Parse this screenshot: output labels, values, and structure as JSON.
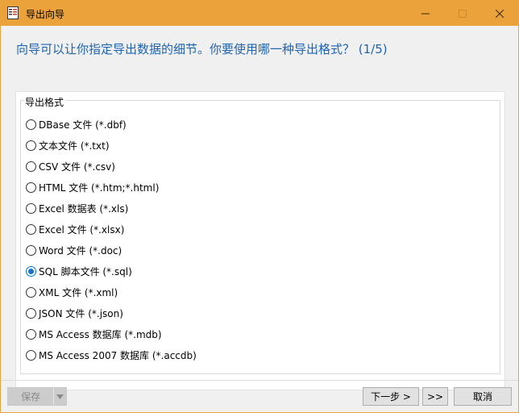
{
  "window": {
    "title": "导出向导",
    "minimize_icon": "minimize-icon",
    "maximize_icon": "maximize-icon",
    "close_icon": "close-icon",
    "accent_color": "#eba23a"
  },
  "header": {
    "text": "向导可以让你指定导出数据的细节。你要使用哪一种导出格式？ (1/5)",
    "color": "#1d64b4"
  },
  "format_group": {
    "legend": "导出格式",
    "selected_index": 7,
    "options": [
      {
        "label": "DBase 文件 (*.dbf)",
        "checked": false
      },
      {
        "label": "文本文件 (*.txt)",
        "checked": false
      },
      {
        "label": "CSV 文件 (*.csv)",
        "checked": false
      },
      {
        "label": "HTML 文件 (*.htm;*.html)",
        "checked": false
      },
      {
        "label": "Excel 数据表 (*.xls)",
        "checked": false
      },
      {
        "label": "Excel 文件 (*.xlsx)",
        "checked": false
      },
      {
        "label": "Word 文件 (*.doc)",
        "checked": false
      },
      {
        "label": "SQL 脚本文件 (*.sql)",
        "checked": true
      },
      {
        "label": "XML 文件 (*.xml)",
        "checked": false
      },
      {
        "label": "JSON 文件 (*.json)",
        "checked": false
      },
      {
        "label": "MS Access 数据库 (*.mdb)",
        "checked": false
      },
      {
        "label": "MS Access 2007 数据库 (*.accdb)",
        "checked": false
      }
    ]
  },
  "footer": {
    "save_label": "保存",
    "next_label": "下一步 >",
    "last_label": ">>",
    "cancel_label": "取消"
  }
}
